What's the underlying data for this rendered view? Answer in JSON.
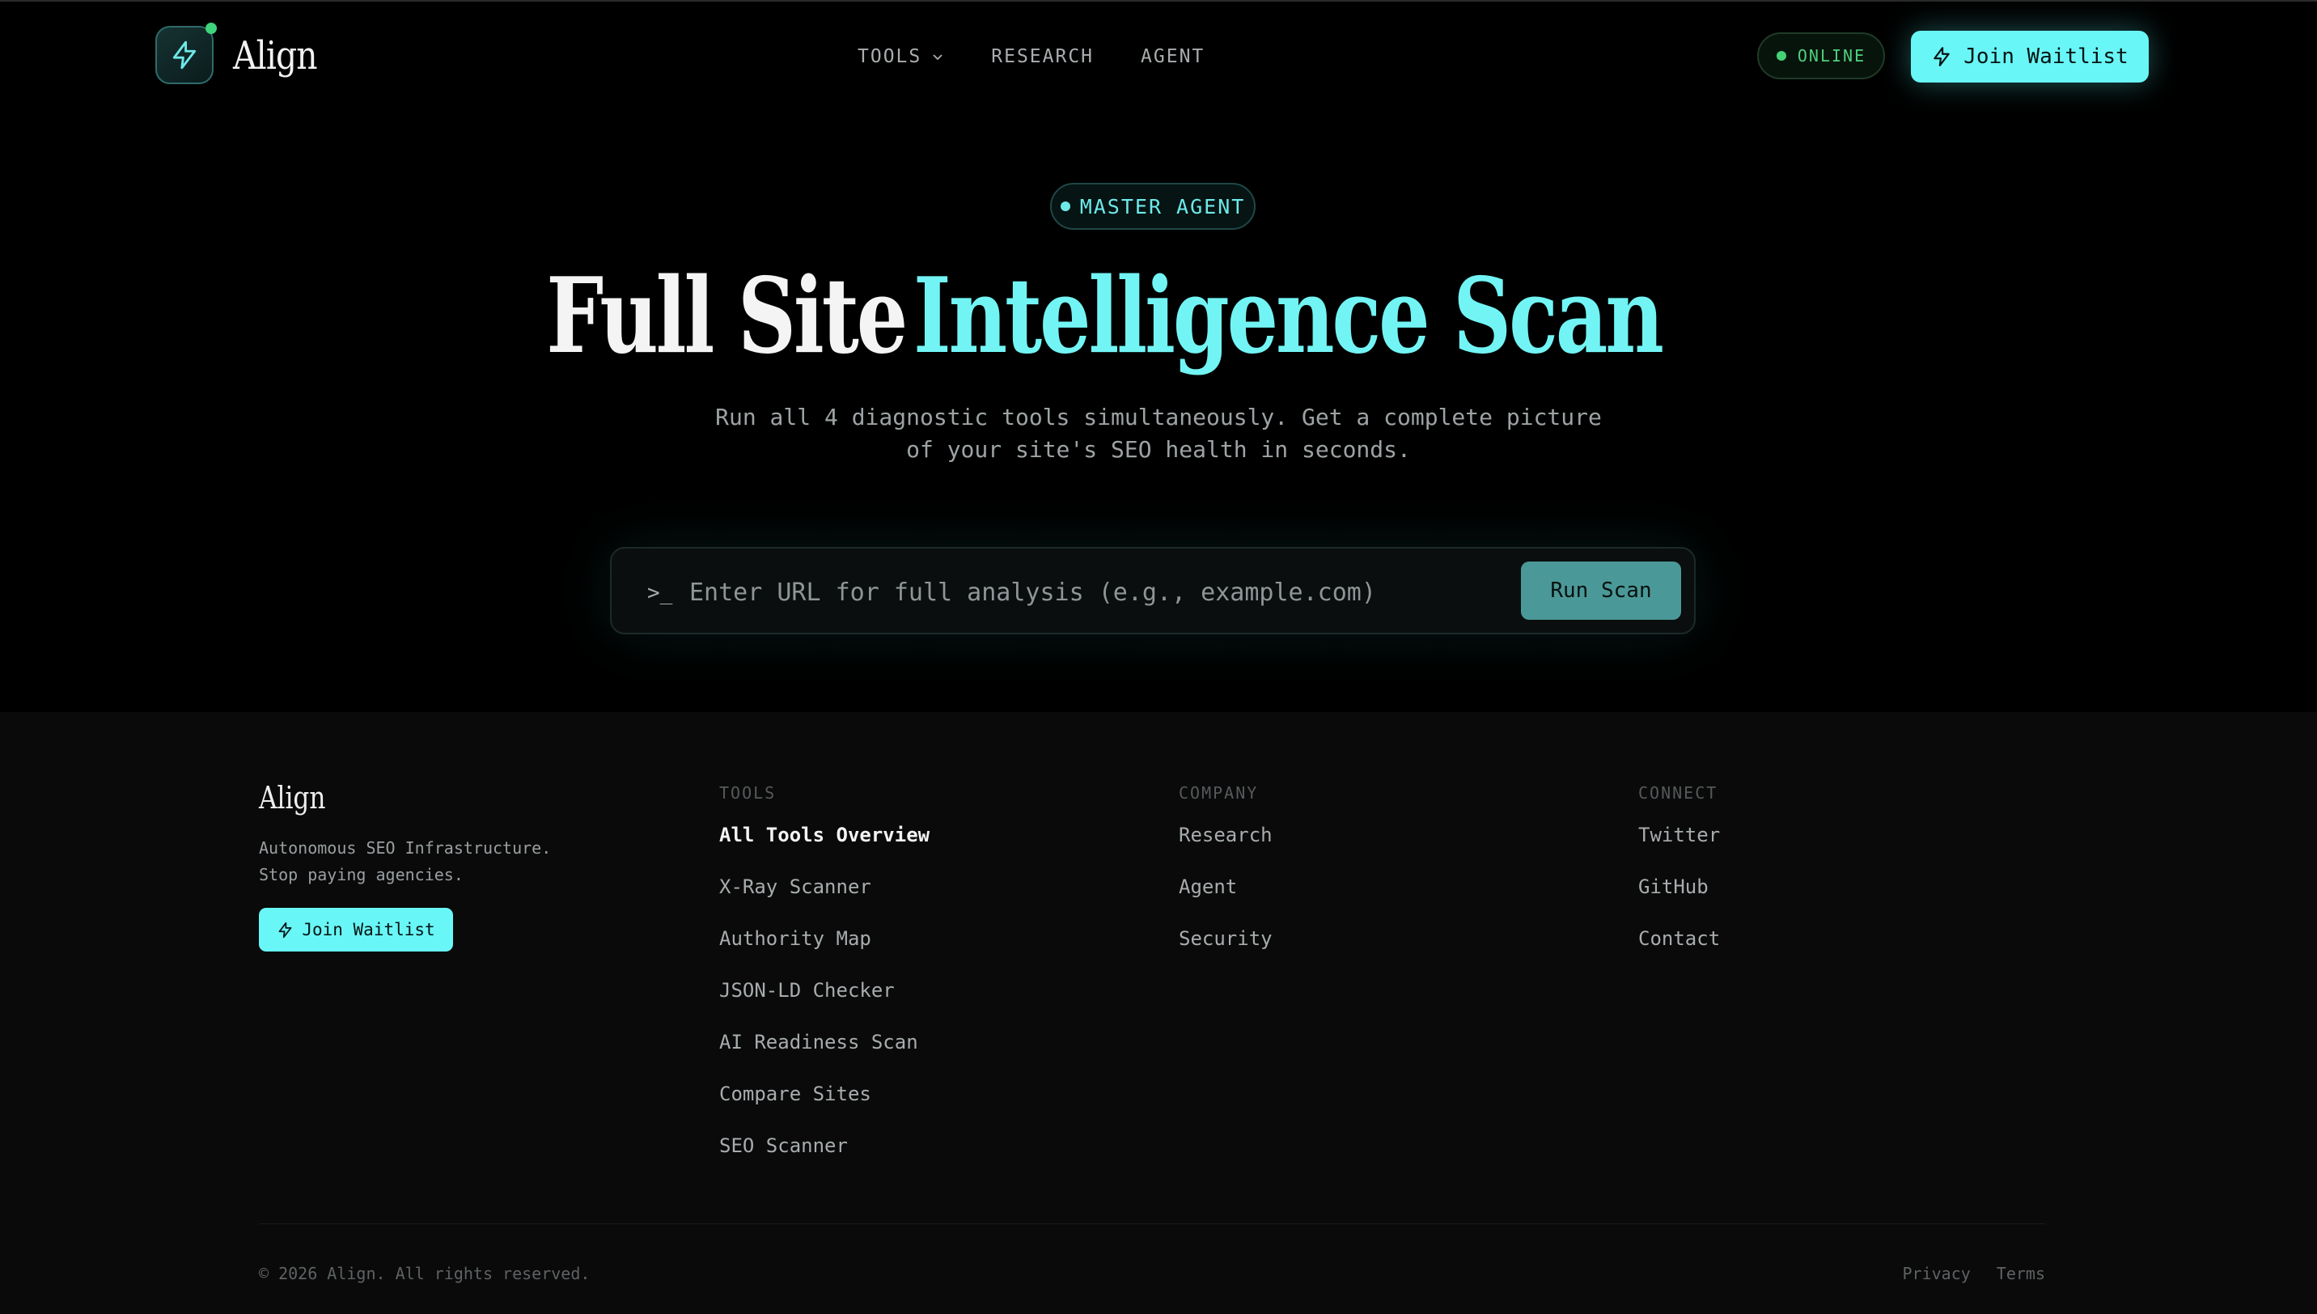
{
  "brand": {
    "name": "Align"
  },
  "nav": {
    "items": [
      {
        "label": "TOOLS",
        "has_dropdown": true
      },
      {
        "label": "RESEARCH"
      },
      {
        "label": "AGENT"
      }
    ]
  },
  "header": {
    "status_label": "ONLINE",
    "join_label": "Join Waitlist"
  },
  "hero": {
    "badge": "MASTER AGENT",
    "title_plain": "Full Site",
    "title_accent": "Intelligence Scan",
    "subtitle_line1": "Run all 4 diagnostic tools simultaneously. Get a complete picture",
    "subtitle_line2": "of your site's SEO health in seconds.",
    "prompt_symbol": ">_",
    "input_placeholder": "Enter URL for full analysis (e.g., example.com)",
    "input_value": "",
    "run_label": "Run Scan"
  },
  "footer": {
    "brand": "Align",
    "tagline_line1": "Autonomous SEO Infrastructure.",
    "tagline_line2": "Stop paying agencies.",
    "join_label": "Join Waitlist",
    "columns": [
      {
        "heading": "TOOLS",
        "links": [
          "All Tools Overview",
          "X-Ray Scanner",
          "Authority Map",
          "JSON-LD Checker",
          "AI Readiness Scan",
          "Compare Sites",
          "SEO Scanner"
        ]
      },
      {
        "heading": "COMPANY",
        "links": [
          "Research",
          "Agent",
          "Security"
        ]
      },
      {
        "heading": "CONNECT",
        "links": [
          "Twitter",
          "GitHub",
          "Contact"
        ]
      }
    ],
    "copyright": "© 2026 Align. All rights reserved.",
    "legal": [
      "Privacy",
      "Terms"
    ]
  },
  "colors": {
    "accent": "#69f6f6",
    "accent_text": "#72f4f4",
    "online_green": "#4ed07c",
    "background": "#000000",
    "footer_background": "#0a0a0a"
  },
  "icons": {
    "logo": "lightning-bolt-icon",
    "nav_dropdown": "chevron-down-icon",
    "join": "lightning-bolt-icon",
    "status": "status-dot-icon"
  }
}
